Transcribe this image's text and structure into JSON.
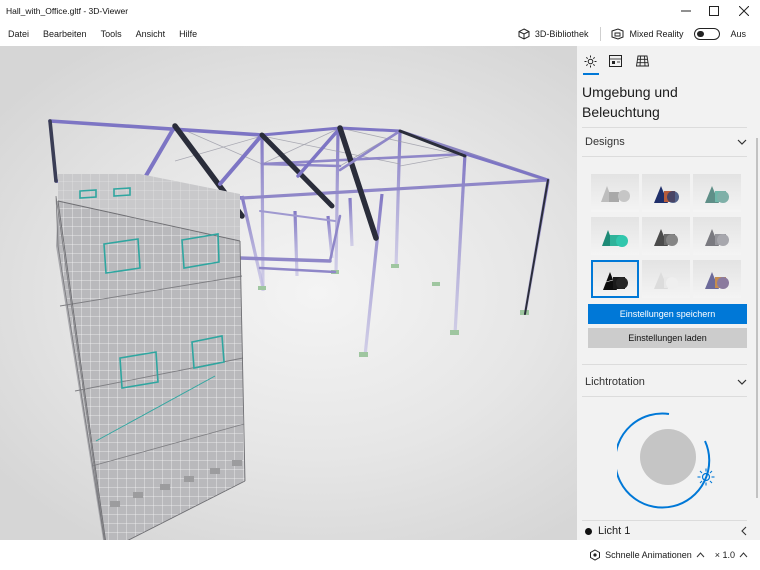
{
  "window": {
    "title": "Hall_with_Office.gltf - 3D-Viewer"
  },
  "menu": {
    "items": [
      "Datei",
      "Bearbeiten",
      "Tools",
      "Ansicht",
      "Hilfe"
    ]
  },
  "toolbar": {
    "library_label": "3D-Bibliothek",
    "mixed_reality_label": "Mixed Reality",
    "toggle_state_label": "Aus"
  },
  "panel": {
    "tabs": [
      "sun-icon",
      "stats-icon",
      "grid-icon"
    ],
    "title": "Umgebung und Beleuchtung",
    "designs_header": "Designs",
    "designs_selected_index": 6,
    "save_button": "Einstellungen speichern",
    "load_button": "Einstellungen laden",
    "rotation_header": "Lichtrotation",
    "light_label": "Licht 1"
  },
  "status": {
    "animations_label": "Schnelle Animationen",
    "zoom_label": "× 1.0"
  },
  "colors": {
    "accent": "#0078d7",
    "beam_purple": "#8f87c8",
    "beam_dark": "#2a2d3a"
  }
}
